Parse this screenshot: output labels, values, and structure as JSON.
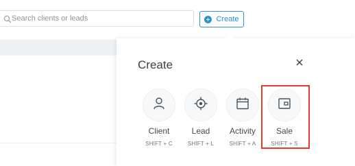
{
  "search": {
    "placeholder": "Search clients or leads"
  },
  "toolbar": {
    "create_label": "Create"
  },
  "popover": {
    "title": "Create",
    "items": [
      {
        "label": "Client",
        "shortcut": "SHIFT + C",
        "icon": "person-icon"
      },
      {
        "label": "Lead",
        "shortcut": "SHIFT + L",
        "icon": "target-icon"
      },
      {
        "label": "Activity",
        "shortcut": "SHIFT + A",
        "icon": "calendar-icon"
      },
      {
        "label": "Sale",
        "shortcut": "SHIFT + S",
        "icon": "wallet-icon"
      }
    ]
  },
  "colors": {
    "accent": "#2e93d1",
    "highlight": "#e03b2f"
  }
}
